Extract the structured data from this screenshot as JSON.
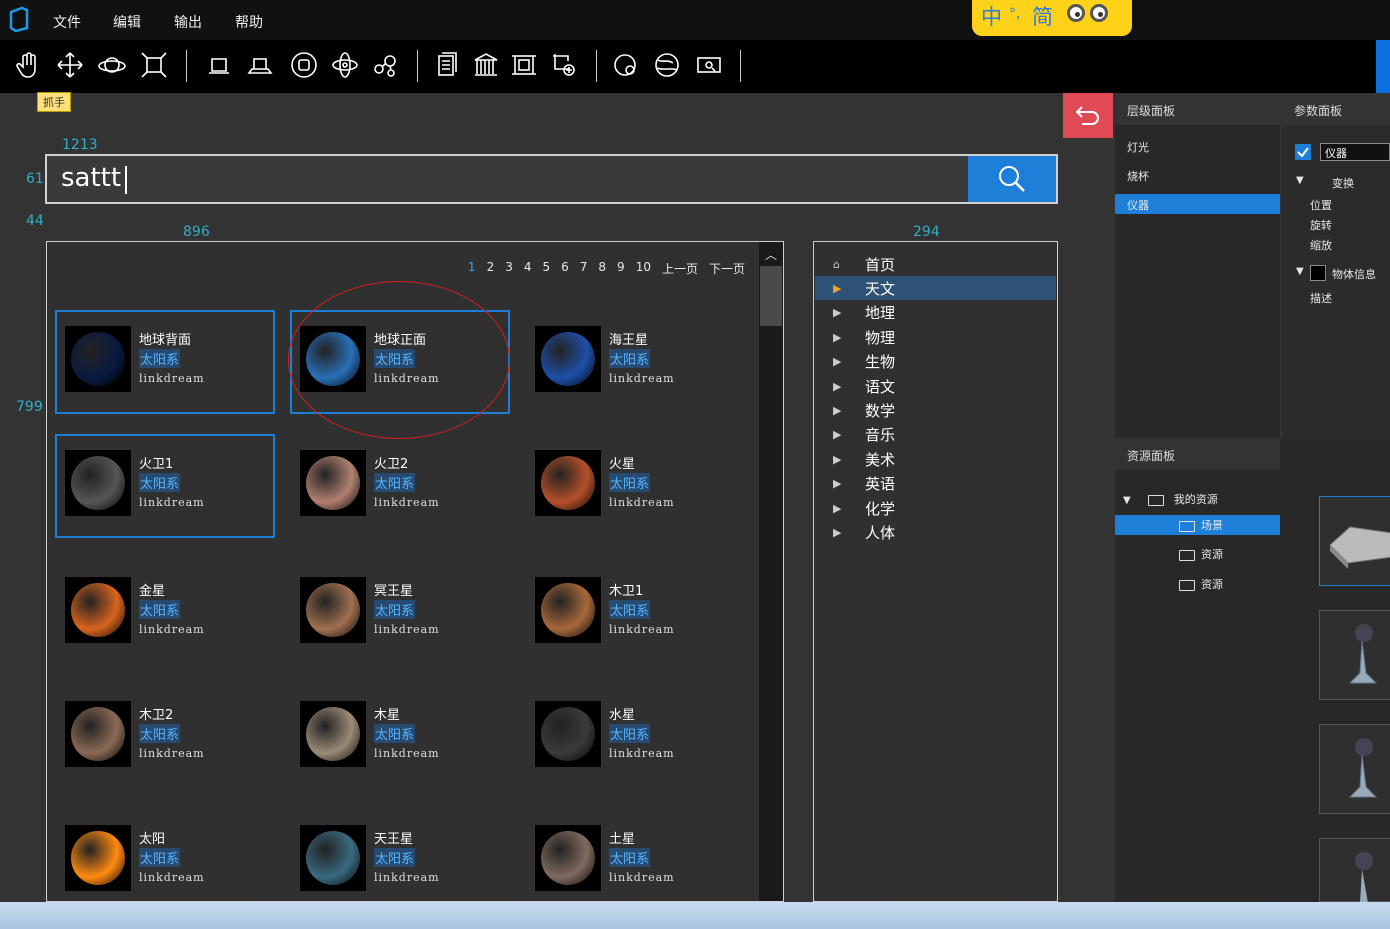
{
  "menu": [
    "文件",
    "编辑",
    "输出",
    "帮助"
  ],
  "ime": {
    "lang": "中",
    "mode": "简"
  },
  "toolbar": {
    "tools": [
      "hand-icon",
      "move-icon",
      "orbit-icon",
      "scale-icon",
      "box-icon",
      "platform-icon",
      "circle-icon",
      "atom-icon",
      "molecule-icon",
      "document-icon",
      "building-icon",
      "frame-icon",
      "transform-icon",
      "camera-icon",
      "globe-icon",
      "screen-icon"
    ],
    "tooltip": "抓手"
  },
  "dims": {
    "width_top": "1213",
    "search_h": "61",
    "gap": "44",
    "results_w": "896",
    "cats_w": "294",
    "results_h": "799"
  },
  "search": {
    "value": "sattt"
  },
  "pager": {
    "pages": [
      "1",
      "2",
      "3",
      "4",
      "5",
      "6",
      "7",
      "8",
      "9",
      "10"
    ],
    "current": "1",
    "prev": "上一页",
    "next": "下一页"
  },
  "results": [
    {
      "name": "地球背面",
      "tag": "太阳系",
      "sub": "linkdream",
      "selected": true,
      "color": "#0a1a40"
    },
    {
      "name": "地球正面",
      "tag": "太阳系",
      "sub": "linkdream",
      "selected": true,
      "color": "#2a6fb8"
    },
    {
      "name": "海王星",
      "tag": "太阳系",
      "sub": "linkdream",
      "selected": false,
      "color": "#1f4fa8"
    },
    {
      "name": "火卫1",
      "tag": "太阳系",
      "sub": "linkdream",
      "selected": true,
      "color": "#555555"
    },
    {
      "name": "火卫2",
      "tag": "太阳系",
      "sub": "linkdream",
      "selected": false,
      "color": "#b08070"
    },
    {
      "name": "火星",
      "tag": "太阳系",
      "sub": "linkdream",
      "selected": false,
      "color": "#b5502a"
    },
    {
      "name": "金星",
      "tag": "太阳系",
      "sub": "linkdream",
      "selected": false,
      "color": "#d8641e"
    },
    {
      "name": "冥王星",
      "tag": "太阳系",
      "sub": "linkdream",
      "selected": false,
      "color": "#a07050"
    },
    {
      "name": "木卫1",
      "tag": "太阳系",
      "sub": "linkdream",
      "selected": false,
      "color": "#a8683a"
    },
    {
      "name": "木卫2",
      "tag": "太阳系",
      "sub": "linkdream",
      "selected": false,
      "color": "#8a6a55"
    },
    {
      "name": "木星",
      "tag": "太阳系",
      "sub": "linkdream",
      "selected": false,
      "color": "#9a8a78"
    },
    {
      "name": "水星",
      "tag": "太阳系",
      "sub": "linkdream",
      "selected": false,
      "color": "#3a3a3a"
    },
    {
      "name": "太阳",
      "tag": "太阳系",
      "sub": "linkdream",
      "selected": false,
      "color": "#ff8a10"
    },
    {
      "name": "天王星",
      "tag": "太阳系",
      "sub": "linkdream",
      "selected": false,
      "color": "#3a6a80"
    },
    {
      "name": "土星",
      "tag": "太阳系",
      "sub": "linkdream",
      "selected": false,
      "color": "#806a60"
    }
  ],
  "categories": [
    {
      "label": "首页",
      "icon": "home-icon",
      "selected": false
    },
    {
      "label": "天文",
      "icon": "arrow-icon",
      "selected": true
    },
    {
      "label": "地理",
      "icon": "arrow-icon",
      "selected": false
    },
    {
      "label": "物理",
      "icon": "arrow-icon",
      "selected": false
    },
    {
      "label": "生物",
      "icon": "arrow-icon",
      "selected": false
    },
    {
      "label": "语文",
      "icon": "arrow-icon",
      "selected": false
    },
    {
      "label": "数学",
      "icon": "arrow-icon",
      "selected": false
    },
    {
      "label": "音乐",
      "icon": "arrow-icon",
      "selected": false
    },
    {
      "label": "美术",
      "icon": "arrow-icon",
      "selected": false
    },
    {
      "label": "英语",
      "icon": "arrow-icon",
      "selected": false
    },
    {
      "label": "化学",
      "icon": "arrow-icon",
      "selected": false
    },
    {
      "label": "人体",
      "icon": "arrow-icon",
      "selected": false
    }
  ],
  "layer_panel": {
    "title": "层级面板",
    "items": [
      "灯光",
      "烧杯",
      "仪器"
    ],
    "selected": "仪器"
  },
  "param_panel": {
    "title": "参数面板",
    "name_value": "仪器",
    "transform": "变换",
    "position": "位置",
    "rotation": "旋转",
    "scale": "缩放",
    "object_info": "物体信息",
    "description": "描述"
  },
  "resource_panel": {
    "title": "资源面板",
    "root": "我的资源",
    "items": [
      "场景",
      "资源",
      "资源"
    ],
    "selected": "场景"
  },
  "colors": {
    "accent": "#1e7fd8",
    "tag": "#58b4ff",
    "back": "#e04a55",
    "dim": "#30b0c7"
  }
}
